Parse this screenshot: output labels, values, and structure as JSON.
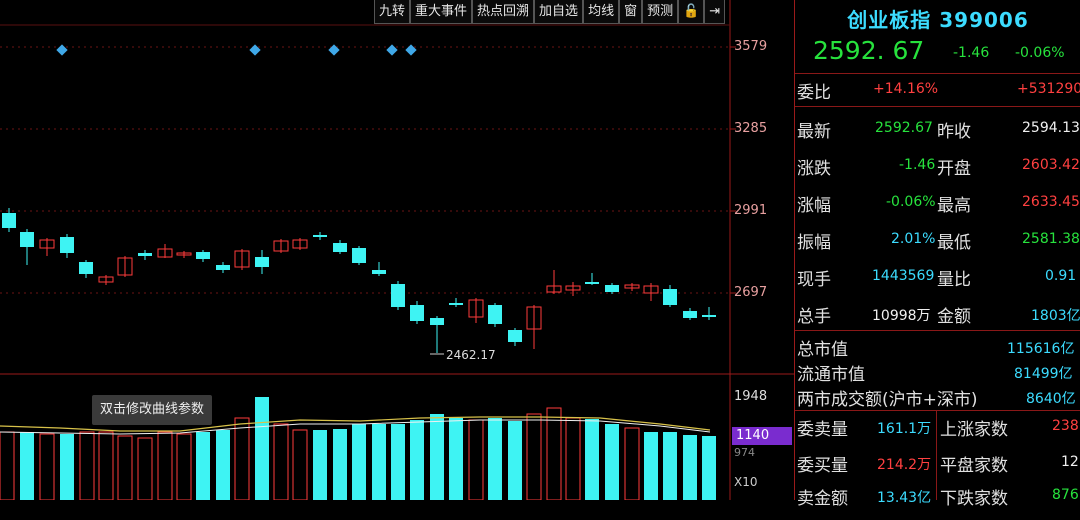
{
  "toolbar": {
    "items": [
      "九转",
      "重大事件",
      "热点回溯",
      "加自选",
      "均线",
      "窗",
      "预测",
      "🔓",
      "⇥"
    ]
  },
  "chart": {
    "price_levels": [
      "3579",
      "3285",
      "2991",
      "2697"
    ],
    "low_label": "2462.17",
    "volume_top": "1948",
    "volume_current": "1140",
    "volume_partial": "974",
    "multiplier": "X10",
    "tooltip": "双击修改曲线参数",
    "colors": {
      "up": "#ff3b3b",
      "down": "#3ef3f3",
      "marker": "#3fa8e8",
      "ma": "#d8c24a"
    }
  },
  "quote": {
    "name": "创业板指",
    "code": "399006",
    "price": "2592. 67",
    "change": "-1.46",
    "change_pct": "-0.06%",
    "webi_label": "委比",
    "webi_pct": "+14.16%",
    "webi_val": "+531290",
    "rows": [
      {
        "l1": "最新",
        "v1": "2592.67",
        "l2": "昨收",
        "v2": "2594.13"
      },
      {
        "l1": "涨跌",
        "v1": "-1.46",
        "l2": "开盘",
        "v2": "2603.42"
      },
      {
        "l1": "涨幅",
        "v1": "-0.06%",
        "l2": "最高",
        "v2": "2633.45"
      },
      {
        "l1": "振幅",
        "v1": "2.01%",
        "l2": "最低",
        "v2": "2581.38"
      },
      {
        "l1": "现手",
        "v1": "1443569",
        "l2": "量比",
        "v2": "0.91"
      },
      {
        "l1": "总手",
        "v1": "10998万",
        "l2": "金额",
        "v2": "1803亿"
      }
    ],
    "mv_rows": [
      {
        "label": "总市值",
        "value": "115616亿"
      },
      {
        "label": "流通市值",
        "value": "81499亿"
      },
      {
        "label": "两市成交额(沪市+深市)",
        "value": "8640亿"
      }
    ],
    "bottom_rows": [
      {
        "l1": "委卖量",
        "v1": "161.1万",
        "l2": "上涨家数",
        "v2": "238"
      },
      {
        "l1": "委买量",
        "v1": "214.2万",
        "l2": "平盘家数",
        "v2": "12"
      },
      {
        "l1": "卖金额",
        "v1": "13.43亿",
        "l2": "下跌家数",
        "v2": "876"
      }
    ]
  }
}
